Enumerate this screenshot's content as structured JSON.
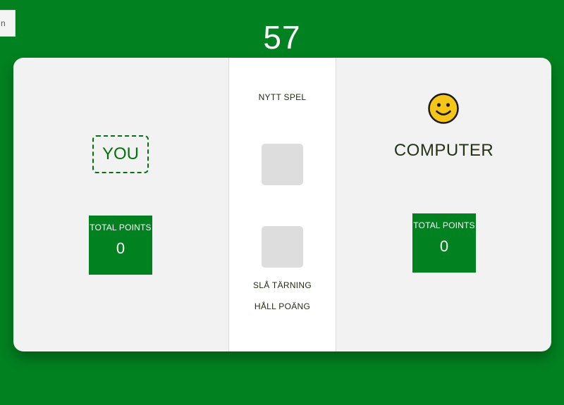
{
  "corner_tab": {
    "label": "n"
  },
  "header": {
    "goal_score": "57"
  },
  "players": {
    "you": {
      "name": "YOU",
      "points_label": "TOTAL POINTS",
      "points": "0"
    },
    "computer": {
      "name": "COMPUTER",
      "points_label": "TOTAL POINTS",
      "points": "0",
      "avatar_icon": "smiley-face-icon"
    }
  },
  "controls": {
    "new_game": "NYTT SPEL",
    "roll_dice": "SLÅ TÄRNING",
    "hold_points": "HÅLL POÄNG"
  },
  "dice": [
    {
      "name": "die-1",
      "value": null
    },
    {
      "name": "die-2",
      "value": null
    }
  ],
  "colors": {
    "background": "#028120",
    "board": "#f2f2f2",
    "center_panel": "#ffffff",
    "accent": "#03710f",
    "points_box": "#028120",
    "die": "#dddddd",
    "smiley": "#f5c518"
  }
}
